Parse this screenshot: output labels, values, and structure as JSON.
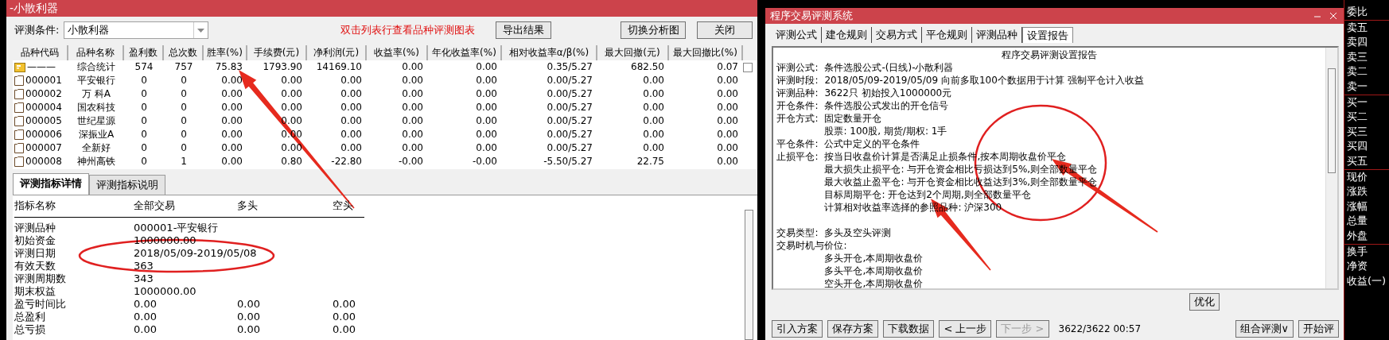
{
  "left_window": {
    "title": "-小散利器",
    "condition_label": "评测条件:",
    "condition_value": "小散利器",
    "hint": "双击列表行查看品种评测图表",
    "buttons": [
      "导出结果",
      "切换分析图",
      "关闭"
    ],
    "table": {
      "columns": [
        "品种代码",
        "品种名称",
        "盈利数",
        "总次数",
        "胜率(%)",
        "手续费(元)",
        "净利润(元)",
        "收益率(%)",
        "年化收益率(%)",
        "相对收益率α/β(%)",
        "最大回撤(元)",
        "最大回撤比(%)"
      ],
      "rows": [
        {
          "kind": "summary",
          "cells": [
            "———",
            "综合统计",
            "574",
            "757",
            "75.83",
            "1793.90",
            "14169.10",
            "0.00",
            "0.00",
            "0.35/5.27",
            "682.50",
            "0.07"
          ]
        },
        {
          "kind": "stock",
          "cells": [
            "000001",
            "平安银行",
            "0",
            "0",
            "0.00",
            "0.00",
            "0.00",
            "0.00",
            "0.00",
            "0.00/5.27",
            "0.00",
            "0.00"
          ]
        },
        {
          "kind": "stock",
          "cells": [
            "000002",
            "万 科A",
            "0",
            "0",
            "0.00",
            "0.00",
            "0.00",
            "0.00",
            "0.00",
            "0.00/5.27",
            "0.00",
            "0.00"
          ]
        },
        {
          "kind": "stock",
          "cells": [
            "000004",
            "国农科技",
            "0",
            "0",
            "0.00",
            "0.00",
            "0.00",
            "0.00",
            "0.00",
            "0.00/5.27",
            "0.00",
            "0.00"
          ]
        },
        {
          "kind": "stock",
          "cells": [
            "000005",
            "世纪星源",
            "0",
            "0",
            "0.00",
            "0.00",
            "0.00",
            "0.00",
            "0.00",
            "0.00/5.27",
            "0.00",
            "0.00"
          ]
        },
        {
          "kind": "stock",
          "cells": [
            "000006",
            "深振业A",
            "0",
            "0",
            "0.00",
            "0.00",
            "0.00",
            "0.00",
            "0.00",
            "0.00/5.27",
            "0.00",
            "0.00"
          ]
        },
        {
          "kind": "stock",
          "cells": [
            "000007",
            "全新好",
            "0",
            "0",
            "0.00",
            "0.00",
            "0.00",
            "0.00",
            "0.00",
            "0.00/5.27",
            "0.00",
            "0.00"
          ]
        },
        {
          "kind": "stock",
          "cells": [
            "000008",
            "神州高铁",
            "0",
            "1",
            "0.00",
            "0.80",
            "-22.80",
            "-0.00",
            "-0.00",
            "-5.50/5.27",
            "22.75",
            "0.00"
          ]
        }
      ]
    },
    "detail_tabs": [
      {
        "label": "评测指标详情",
        "selected": true
      },
      {
        "label": "评测指标说明",
        "selected": false
      }
    ],
    "detail": {
      "columns": [
        "指标名称",
        "全部交易",
        "多头",
        "空头"
      ],
      "rows": [
        {
          "cells": [
            "评测品种",
            "000001-平安银行"
          ]
        },
        {
          "cells": [
            "初始资金",
            "1000000.00"
          ]
        },
        {
          "cells": [
            "评测日期",
            "2018/05/09-2019/05/08"
          ]
        },
        {
          "cells": [
            "有效天数",
            "363"
          ]
        },
        {
          "cells": [
            "评测周期数",
            "343"
          ]
        },
        {
          "cells": [
            "期末权益",
            "1000000.00"
          ]
        },
        {
          "cells": [
            "盈亏时间比",
            "0.00",
            "0.00",
            "0.00"
          ]
        },
        {
          "cells": [
            "总盈利",
            "0.00",
            "0.00",
            "0.00"
          ]
        },
        {
          "cells": [
            "总亏损",
            "0.00",
            "0.00",
            "0.00"
          ]
        }
      ]
    }
  },
  "right_window": {
    "title": "程序交易评测系统",
    "tabs": [
      {
        "label": "评测公式",
        "selected": false
      },
      {
        "label": "建仓规则",
        "selected": false
      },
      {
        "label": "交易方式",
        "selected": false
      },
      {
        "label": "平仓规则",
        "selected": false
      },
      {
        "label": "评测品种",
        "selected": false
      },
      {
        "label": "设置报告",
        "selected": true
      }
    ],
    "report": {
      "title": "程序交易评测设置报告",
      "sections": [
        [
          {
            "label": "评测公式:",
            "value": "条件选股公式-(日线)-小散利器"
          },
          {
            "label": "评测时段:",
            "value": "2018/05/09-2019/05/09 向前多取100个数据用于计算 强制平仓计入收益"
          },
          {
            "label": "评测品种:",
            "value": "3622只 初始投入1000000元"
          },
          {
            "label": "开仓条件:",
            "value": "条件选股公式发出的开仓信号"
          },
          {
            "label": "开仓方式:",
            "value": "固定数量开仓",
            "children": [
              {
                "text": "股票: 100股, 期货/期权: 1手"
              }
            ]
          },
          {
            "label": "平仓条件:",
            "value": "公式中定义的平仓条件"
          },
          {
            "label": "止损平仓:",
            "value": "按当日收盘价计算是否满足止损条件,按本周期收盘价平仓",
            "children": [
              {
                "text": "最大损失止损平仓: 与开仓资金相比亏损达到5%,则全部数量平仓"
              },
              {
                "text": "最大收益止盈平仓: 与开仓资金相比收益达到3%,则全部数量平仓"
              },
              {
                "text": "目标周期平仓: 开仓达到2个周期,则全部数量平仓"
              },
              {
                "text": "计算相对收益率选择的参照品种: 沪深300"
              }
            ]
          }
        ],
        [
          {
            "label": "交易类型:",
            "value": "多头及空头评测"
          },
          {
            "label": "交易时机与价位:",
            "children": [
              {
                "text": "多头开仓,本周期收盘价"
              },
              {
                "text": "多头平仓,本周期收盘价"
              },
              {
                "text": "空头开仓,本周期收盘价"
              }
            ]
          }
        ]
      ]
    },
    "side_button": "优化",
    "buttons": [
      {
        "label": "引入方案",
        "disabled": false
      },
      {
        "label": "保存方案",
        "disabled": false
      },
      {
        "label": "下载数据",
        "disabled": false
      },
      {
        "label": "< 上一步",
        "disabled": false
      },
      {
        "label": "下一步 >",
        "disabled": true
      }
    ],
    "status": "3622/3622 00:57",
    "right_buttons": [
      "组合评测∨",
      "开始评"
    ]
  },
  "quote_labels": [
    "委比",
    "卖五",
    "卖四",
    "卖三",
    "卖二",
    "卖一",
    "买一",
    "买二",
    "买三",
    "买四",
    "买五",
    "现价",
    "涨跌",
    "涨幅",
    "总量",
    "外盘",
    "换手",
    "净资",
    "收益(一)"
  ]
}
